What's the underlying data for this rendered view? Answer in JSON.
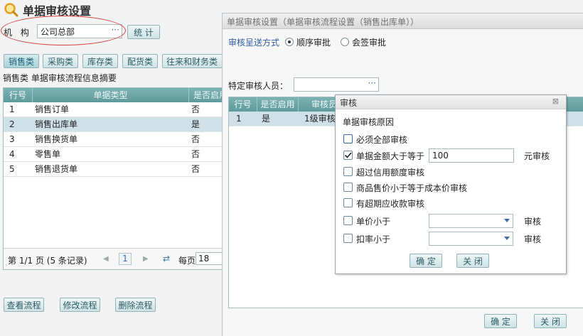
{
  "page": {
    "title": "单据审核设置"
  },
  "org": {
    "label": "机 构",
    "value": "公司总部",
    "ellipsis": "···",
    "stat_button": "统 计"
  },
  "tabs": [
    "销售类",
    "采购类",
    "库存类",
    "配货类",
    "往来和财务类"
  ],
  "summary": "销售类 单据审核流程信息摘要",
  "left_table": {
    "headers": [
      "行号",
      "单据类型",
      "是否启用"
    ],
    "rows": [
      [
        "1",
        "销售订单",
        "否"
      ],
      [
        "2",
        "销售出库单",
        "是"
      ],
      [
        "3",
        "销售换货单",
        "否"
      ],
      [
        "4",
        "零售单",
        "否"
      ],
      [
        "5",
        "销售退货单",
        "否"
      ]
    ]
  },
  "pager": {
    "text": "第 1/1 页 (5 条记录)",
    "prev": "◀",
    "current": "1",
    "next": "▶",
    "refresh": "⇄",
    "per_page_label": "每页",
    "per_page_value": "18"
  },
  "left_buttons": [
    "查看流程",
    "修改流程",
    "删除流程"
  ],
  "main_dialog": {
    "title": "单据审核设置（单据审核流程设置（销售出库单））",
    "send_mode_label": "审核呈送方式",
    "radio_sequential": "顺序审批",
    "radio_joint": "会签审批",
    "approver_label": "特定审核人员：",
    "approver_ellipsis": "···",
    "headers": [
      "行号",
      "是否启用",
      "审核员"
    ],
    "row": [
      "1",
      "是",
      "1级审核"
    ],
    "ok": "确 定",
    "close": "关 闭"
  },
  "audit_dialog": {
    "title": "审核",
    "close_glyph": "⊠",
    "section": "单据审核原因",
    "options": [
      {
        "label": "必须全部审核",
        "checked": false
      },
      {
        "label": "单据金额大于等于",
        "checked": true,
        "value": "100",
        "suffix": "元审核"
      },
      {
        "label": "超过信用额度审核",
        "checked": false
      },
      {
        "label": "商品售价小于等于成本价审核",
        "checked": false
      },
      {
        "label": "有超期应收款审核",
        "checked": false
      },
      {
        "label": "单价小于",
        "checked": false,
        "suffix": "审核"
      },
      {
        "label": "扣率小于",
        "checked": false,
        "suffix": "审核"
      }
    ],
    "ok": "确 定",
    "close": "关 闭"
  }
}
